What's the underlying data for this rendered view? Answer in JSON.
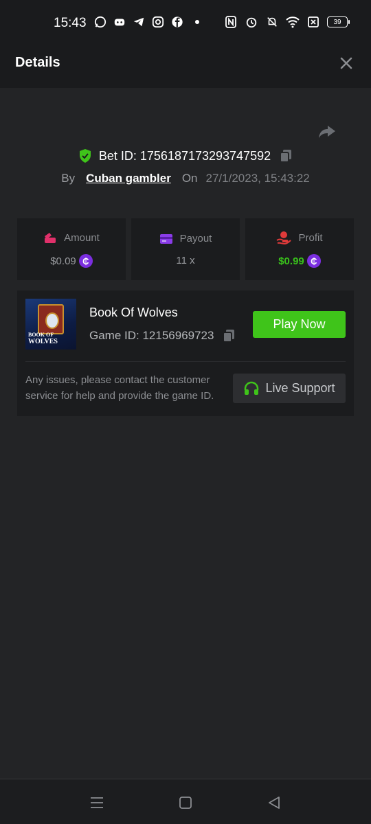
{
  "status_bar": {
    "time": "15:43",
    "battery": "39",
    "left_icons": [
      "whatsapp-icon",
      "discord-icon",
      "telegram-icon",
      "instagram-icon",
      "facebook-icon",
      "dot-icon"
    ],
    "right_icons": [
      "nfc-icon",
      "alarm-icon",
      "mute-icon",
      "wifi-icon",
      "sim-icon",
      "battery-icon"
    ]
  },
  "header": {
    "title": "Details"
  },
  "bet": {
    "id_label": "Bet ID: 1756187173293747592",
    "by_label": "By",
    "user": "Cuban gambler",
    "on_label": "On",
    "date": "27/1/2023, 15:43:22"
  },
  "stats": {
    "amount": {
      "label": "Amount",
      "value": "$0.09"
    },
    "payout": {
      "label": "Payout",
      "value": "11 x"
    },
    "profit": {
      "label": "Profit",
      "value": "$0.99"
    },
    "coin_symbol": "₵"
  },
  "game": {
    "name": "Book Of Wolves",
    "id_label": "Game ID: 12156969723",
    "thumb_text": "BOOK OF WOLVES",
    "play_label": "Play Now",
    "issue_text": "Any issues, please contact the customer service for help and provide the game ID.",
    "support_label": "Live Support"
  },
  "colors": {
    "accent_green": "#3fc41a",
    "profit_green": "#39c11b",
    "coin_purple": "#7b2ee0",
    "amount_pink": "#e0306a",
    "payout_purple": "#8a3ce8",
    "profit_red": "#e03a3a"
  }
}
